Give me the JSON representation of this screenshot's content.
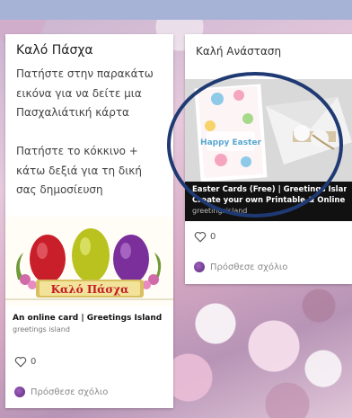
{
  "cards": [
    {
      "title": "Καλό Πάσχα",
      "body": "Πατήστε στην παρακάτω εικόνα για να δείτε μια Πασχαλιάτική κάρτα\n\nΠατήστε το κόκκινο + κάτω δεξιά για τη δική σας δημοσίευση",
      "media_caption": "Καλό Πάσχα",
      "link_title": "An online card | Greetings Island",
      "link_source": "greetings island",
      "likes": "0",
      "comment_label": "Πρόσθεσε σχόλιο"
    },
    {
      "title": "Καλή Ανάσταση",
      "media_caption": "Happy Easter",
      "link_title": "Easter Cards (Free) | Greetings Island",
      "link_description": "Create your own Printable & Online Ea...",
      "link_source": "greetingsisland",
      "likes": "0",
      "comment_label": "Πρόσθεσε σχόλιο"
    }
  ],
  "colors": {
    "topbar": "#a7b3d6",
    "annotation_ellipse": "#1f3a73"
  }
}
